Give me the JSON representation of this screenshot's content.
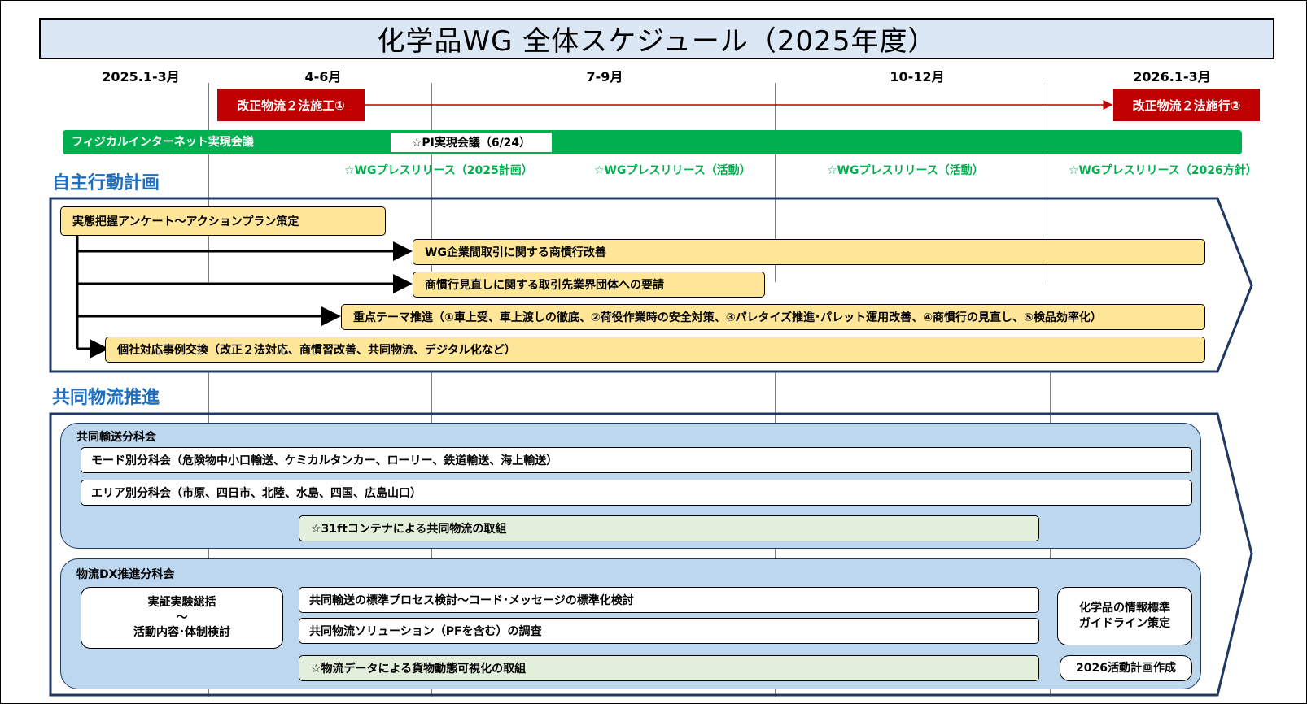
{
  "title": "化学品WG 全体スケジュール（2025年度）",
  "periods": [
    "2025.1-3月",
    "4-6月",
    "7-9月",
    "10-12月",
    "2026.1-3月"
  ],
  "law": {
    "first": "改正物流２法施工①",
    "second": "改正物流２法施行②"
  },
  "pi": {
    "bar_label": "フィジカルインターネット実現会議",
    "meeting": "☆PI実現会議（6/24）"
  },
  "releases": [
    "☆WGプレスリリース（2025計画）",
    "☆WGプレスリリース（活動）",
    "☆WGプレスリリース（活動）",
    "☆WGプレスリリース（2026方針）"
  ],
  "autonomous": {
    "heading": "自主行動計画",
    "items": [
      "実態把握アンケート～アクションプラン策定",
      "WG企業間取引に関する商慣行改善",
      "商慣行見直しに関する取引先業界団体への要請",
      "重点テーマ推進（①車上受、車上渡しの徹底、②荷役作業時の安全対策、③パレタイズ推進･パレット運用改善、④商慣行の見直し、⑤検品効率化）",
      "個社対応事例交換（改正２法対応、商慣習改善、共同物流、デジタル化など）"
    ]
  },
  "joint": {
    "heading": "共同物流推進",
    "transport": {
      "label": "共同輸送分科会",
      "items": [
        "モード別分科会（危険物中小口輸送、ケミカルタンカー、ローリー、鉄道輸送、海上輸送）",
        "エリア別分科会（市原、四日市、北陸、水島、四国、広島山口）",
        "☆31ftコンテナによる共同物流の取組"
      ]
    },
    "dx": {
      "label": "物流DX推進分科会",
      "demo_line1": "実証実験総括",
      "demo_line2": "～",
      "demo_line3": "活動内容･体制検討",
      "items": [
        "共同輸送の標準プロセス検討～コード･メッセージの標準化検討",
        "共同物流ソリューション（PFを含む）の調査",
        "☆物流データによる貨物動態可視化の取組"
      ],
      "guideline_line1": "化学品の情報標準",
      "guideline_line2": "ガイドライン策定",
      "plan": "2026活動計画作成"
    }
  },
  "colors": {
    "accent_red": "#c00000",
    "accent_green": "#00b050",
    "heading_blue": "#1f6fbf",
    "yellow": "#ffe699",
    "panel_blue": "#bdd7ee",
    "light_green": "#e2efda",
    "frame_navy": "#1f3864"
  }
}
